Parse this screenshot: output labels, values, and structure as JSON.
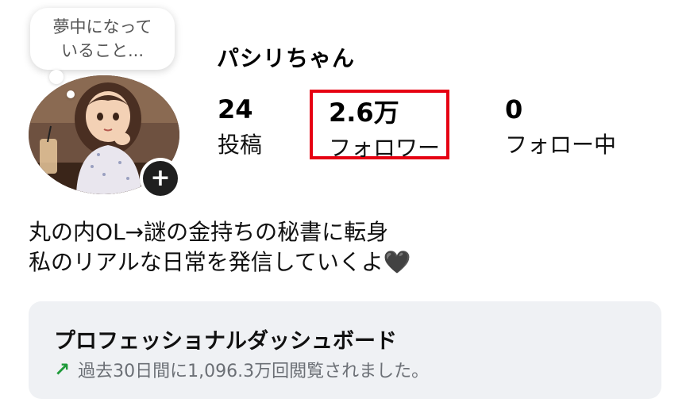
{
  "profile": {
    "note_bubble": {
      "line1": "夢中になって",
      "line2": "いること..."
    },
    "username": "パシリちゃん",
    "stats": {
      "posts": {
        "value": "24",
        "label": "投稿"
      },
      "followers": {
        "value": "2.6万",
        "label": "フォロワー"
      },
      "following": {
        "value": "0",
        "label": "フォロー中"
      }
    },
    "bio": {
      "line1": "丸の内OL→謎の金持ちの秘書に転身",
      "line2": "私のリアルな日常を発信していくよ🖤"
    },
    "add_story_symbol": "+"
  },
  "dashboard": {
    "title": "プロフェッショナルダッシュボード",
    "subtitle": "過去30日間に1,096.3万回閲覧されました。",
    "arrow_symbol": "↗"
  },
  "colors": {
    "highlight_border": "#e60012",
    "trend_arrow": "#1f9a3a",
    "dashboard_bg": "#eff1f4"
  }
}
